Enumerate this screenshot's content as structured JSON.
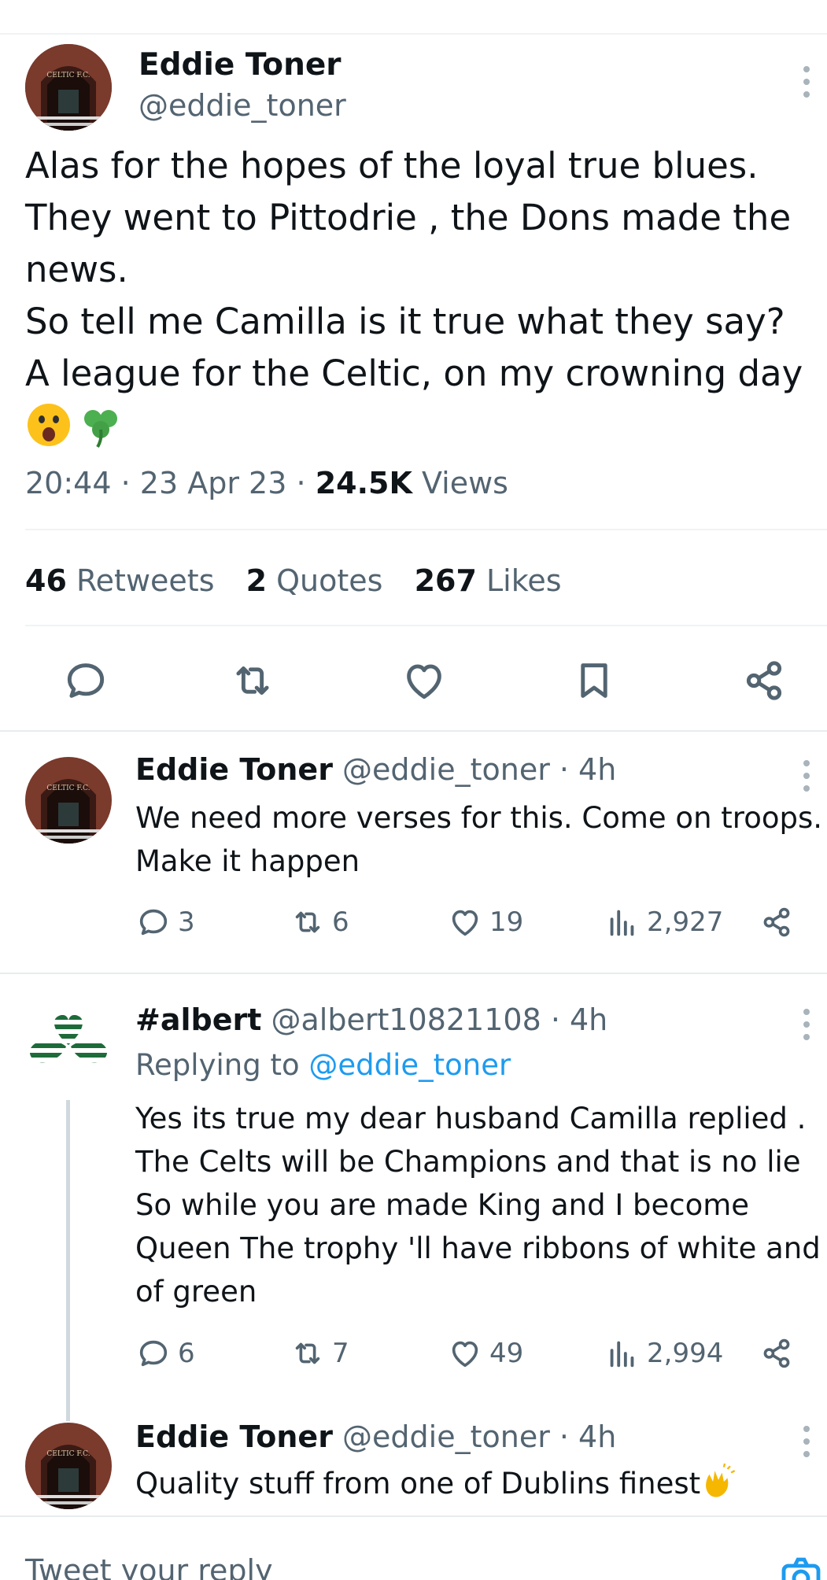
{
  "colors": {
    "text": "#0f1419",
    "muted": "#536471",
    "accent": "#1d9bf0",
    "divider": "#eff3f4"
  },
  "main_tweet": {
    "author_name": "Eddie Toner",
    "author_handle": "@eddie_toner",
    "avatar_icon": "celtic-park-gate-avatar",
    "lines": [
      "Alas for the hopes of the loyal true blues.",
      "They went to Pittodrie , the Dons made the",
      "news.",
      "So tell me Camilla is it true what they say?",
      "A league for the Celtic, on my crowning day"
    ],
    "emojis": [
      "face-with-open-mouth-emoji",
      "shamrock-emoji"
    ],
    "time": "20:44",
    "date": "23 Apr 23",
    "views_count": "24.5K",
    "views_label": "Views",
    "separator": "·",
    "retweets_count": "46",
    "retweets_label": "Retweets",
    "quotes_count": "2",
    "quotes_label": "Quotes",
    "likes_count": "267",
    "likes_label": "Likes",
    "actions": [
      "reply-icon",
      "retweet-icon",
      "like-icon",
      "bookmark-icon",
      "share-icon"
    ]
  },
  "replies": [
    {
      "author_name": "Eddie Toner",
      "author_handle": "@eddie_toner · 4h",
      "lines": [
        "We need more verses for this. Come on troops.",
        "Make it happen"
      ],
      "reply_count": "3",
      "retweet_count": "6",
      "like_count": "19",
      "view_count": "2,927"
    },
    {
      "author_name": "#albert",
      "author_handle": "@albert10821108 · 4h",
      "replying_label": "Replying to",
      "replying_to": "@eddie_toner",
      "avatar_icon": "green-white-shamrock-avatar",
      "lines": [
        "Yes its true my dear husband Camilla replied .",
        "The Celts will be Champions and that is no lie",
        "So while you are made King and I become",
        "Queen The trophy 'll have ribbons of white and",
        "of green"
      ],
      "reply_count": "6",
      "retweet_count": "7",
      "like_count": "49",
      "view_count": "2,994"
    },
    {
      "author_name": "Eddie Toner",
      "author_handle": "@eddie_toner · 4h",
      "text": "Quality stuff from one of Dublins finest",
      "emoji": "clapping-hands-emoji"
    }
  ],
  "composer": {
    "placeholder": "Tweet your reply",
    "camera_icon": "camera-icon"
  }
}
